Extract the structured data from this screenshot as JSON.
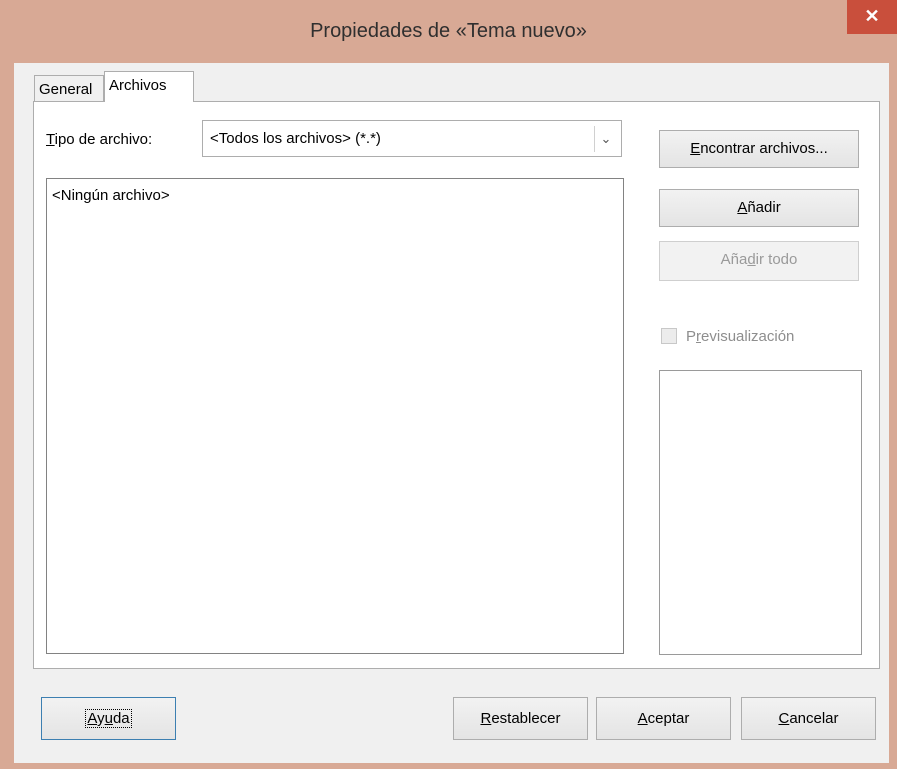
{
  "window": {
    "title": "Propiedades de «Tema nuevo»",
    "close_glyph": "✕"
  },
  "tabs": [
    {
      "label": "General"
    },
    {
      "label": "Archivos"
    }
  ],
  "file_type": {
    "label": "Tipo de archivo:",
    "value": "<Todos los archivos> (*.*)"
  },
  "file_list": {
    "items": [
      "<Ningún archivo>"
    ]
  },
  "buttons": {
    "find_files": "Encontrar archivos...",
    "add": "Añadir",
    "add_all": "Añadir todo",
    "help": "Ayuda",
    "reset": "Restablecer",
    "ok": "Aceptar",
    "cancel": "Cancelar"
  },
  "preview": {
    "label": "Previsualización",
    "checked": false,
    "enabled": false
  }
}
